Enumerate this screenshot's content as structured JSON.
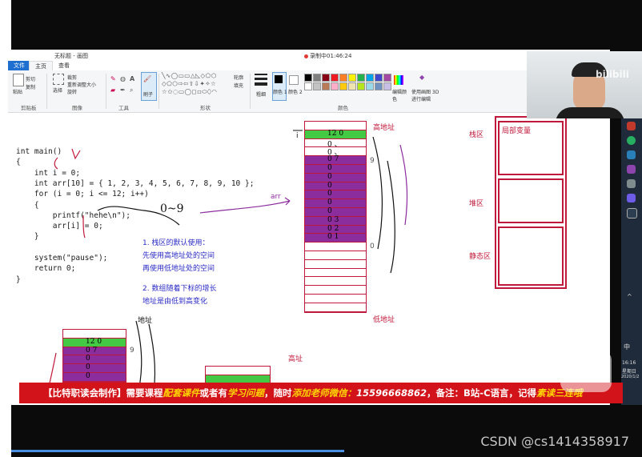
{
  "window": {
    "title": "无标题 - 画图",
    "recording": "录制中01:46:24"
  },
  "tabs": [
    {
      "label": "文件"
    },
    {
      "label": "主页"
    },
    {
      "label": "查看"
    }
  ],
  "ribbon": {
    "clipboard": {
      "label": "剪贴板",
      "paste": "粘贴",
      "cut": "剪切",
      "copy": "复制"
    },
    "image": {
      "label": "图像",
      "crop": "裁剪",
      "resize": "重新调整大小",
      "rotate": "旋转",
      "select": "选择"
    },
    "tools": {
      "label": "工具"
    },
    "brush": {
      "label": "刷子"
    },
    "shapes": {
      "label": "形状",
      "outline": "轮廓",
      "fill": "填充"
    },
    "size": {
      "label": "粗细"
    },
    "colors": {
      "label": "颜色",
      "color1": "颜色 1",
      "color2": "颜色 2",
      "edit": "编辑颜色",
      "paint3d": "使用画图 3D 进行编辑"
    },
    "palette": [
      "#000000",
      "#7f7f7f",
      "#880015",
      "#ed1c24",
      "#ff7f27",
      "#fff200",
      "#22b14c",
      "#00a2e8",
      "#3f48cc",
      "#a349a4",
      "#ffffff",
      "#c3c3c3",
      "#b97a57",
      "#ffaec9",
      "#ffc90e",
      "#efe4b0",
      "#b5e61d",
      "#99d9ea",
      "#7092be",
      "#c8bfe7"
    ]
  },
  "code": {
    "lines": [
      "int main()",
      "{",
      "    int i = 0;",
      "    int arr[10] = { 1, 2, 3, 4, 5, 6, 7, 8, 9, 10 };",
      "    for (i = 0; i <= 12; i++)",
      "    {",
      "        printf(\"hehe\\n\");",
      "        arr[i] = 0;",
      "    }",
      "",
      "    system(\"pause\");",
      "    return 0;",
      "}"
    ]
  },
  "annotations": {
    "arr": "arr",
    "range": "0~9",
    "high_addr": "高地址",
    "low_addr": "低地址",
    "high_addr2": "高址",
    "addr": "地址",
    "nine": "9",
    "zero": "0",
    "i_label": "i",
    "note1_title": "1. 栈区的默认使用：",
    "note1_line1": "先使用高地址处的空间",
    "note1_line2": "再使用低地址处的空间",
    "note2_title": "2. 数组随着下标的增长",
    "note2_line1": "地址是由低到高变化"
  },
  "memory": {
    "stack": "栈区",
    "heap": "堆区",
    "static": "静态区",
    "locals": "局部变量"
  },
  "stack_cells": [
    "12 0",
    "0 、",
    "0 、",
    "0 7",
    "0",
    "0",
    "0",
    "0",
    "0",
    "0",
    "0 3",
    "0 2",
    "0 1"
  ],
  "small_stack_cells": [
    "12 0",
    "0 7",
    "0",
    "0",
    "0"
  ],
  "banner": {
    "part1": "【比特职读会制作】需要课程",
    "part2": "配套课件",
    "part3": "或者有",
    "part4": "学习问题",
    "part5": "，随时",
    "part6": "添加老师微信：",
    "part7": "15596668862",
    "part8": "，备注：B站-C语言，记得",
    "part9": "素读三连哦"
  },
  "taskbar": {
    "time": "16:16",
    "day": "星期日",
    "date": "2020/1/2",
    "lang": "中"
  },
  "bilibili": "bilibili",
  "watermark": "CSDN @cs1414358917"
}
